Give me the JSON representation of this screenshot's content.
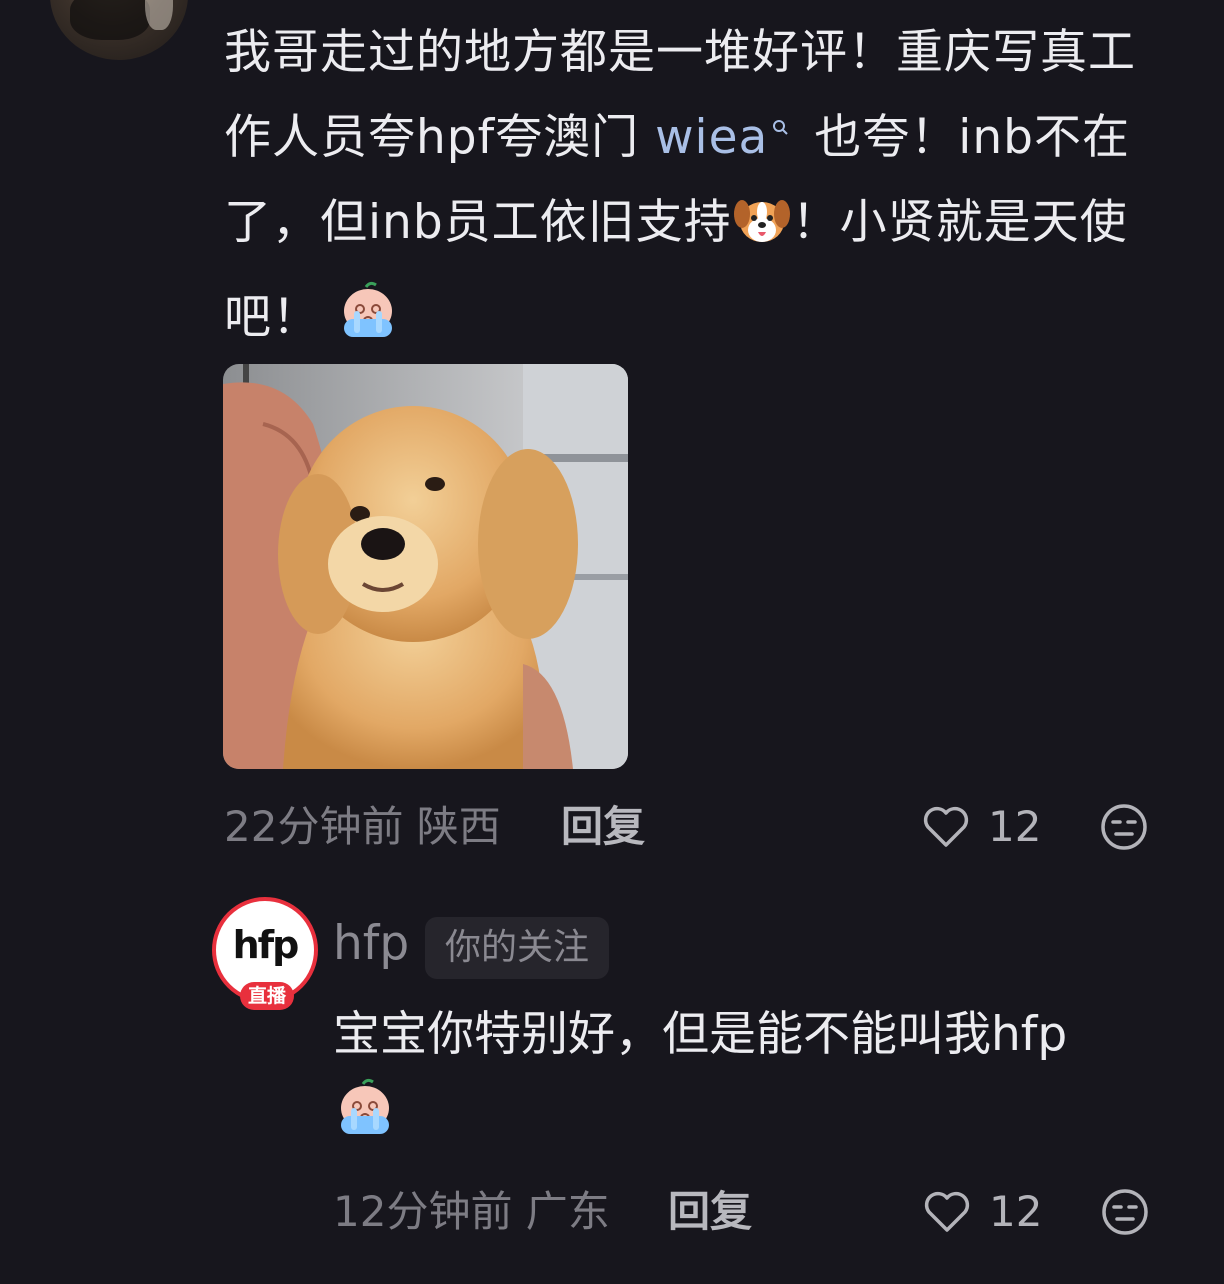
{
  "comment": {
    "text_before_link": "我哥走过的地方都是一堆好评！重庆写真工作人员夸hpf夸澳门 ",
    "link_text": "wiea",
    "text_mid": " 也夸！inb不在了，但inb员工依旧支持",
    "dog_emoji": "🐶",
    "text_after": "！小贤就是天使吧！",
    "cry_emoji_icon": "crying-emoji-icon",
    "time_location": "22分钟前 陕西",
    "reply_label": "回复",
    "like_count": "12"
  },
  "reply": {
    "avatar_logo": "hfp",
    "live_badge": "直播",
    "username": "hfp",
    "follow_tag": "你的关注",
    "text": "宝宝你特别好，但是能不能叫我hfp",
    "time_location": "12分钟前 广东",
    "reply_label": "回复",
    "like_count": "12"
  },
  "colors": {
    "background": "#17161d",
    "link": "#a9bfe6",
    "live_red": "#e8303d"
  }
}
